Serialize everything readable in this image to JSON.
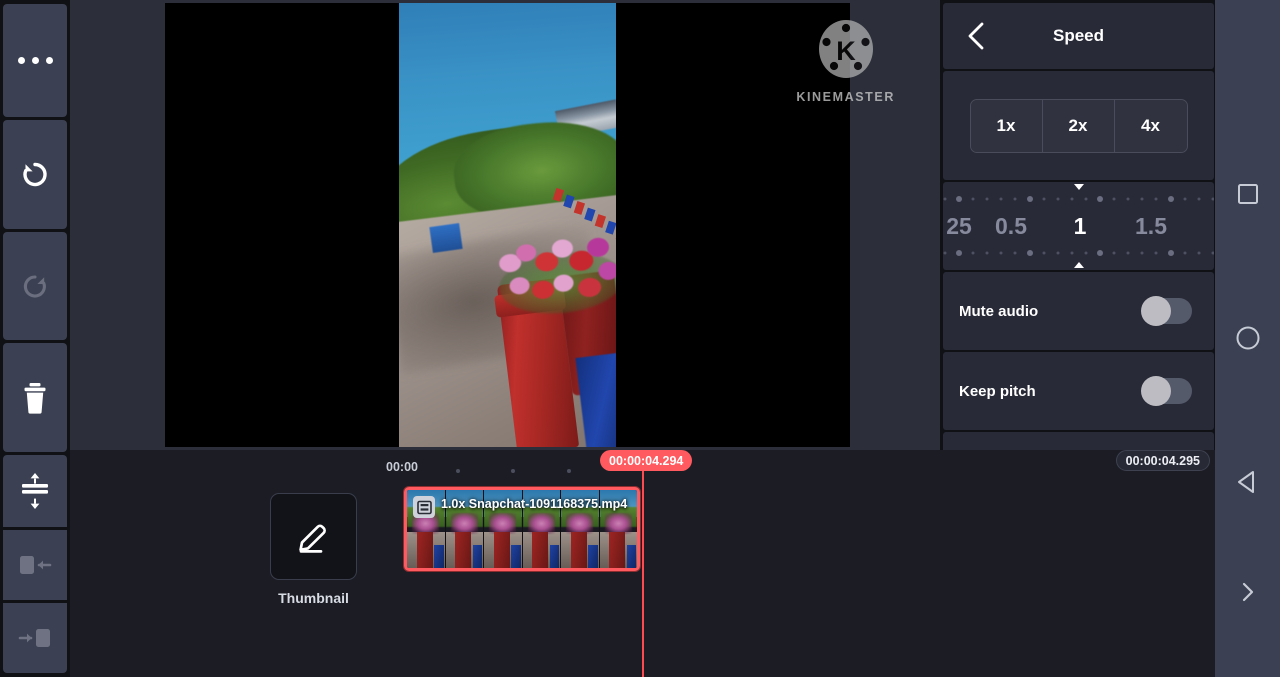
{
  "app": {
    "name": "KineMaster",
    "watermark_text": "KINEMASTER"
  },
  "left_toolbar": {
    "items": [
      {
        "name": "more-options",
        "icon": "ellipsis-icon",
        "enabled": true
      },
      {
        "name": "undo",
        "icon": "undo-icon",
        "enabled": true
      },
      {
        "name": "redo",
        "icon": "redo-icon",
        "enabled": false
      },
      {
        "name": "delete",
        "icon": "trash-icon",
        "enabled": true
      },
      {
        "name": "split",
        "icon": "split-icon",
        "enabled": true
      },
      {
        "name": "trim-left",
        "icon": "trim-left-icon",
        "enabled": false
      },
      {
        "name": "trim-right",
        "icon": "trim-right-icon",
        "enabled": false
      }
    ]
  },
  "panel": {
    "title": "Speed",
    "back_icon": "chevron-left-icon",
    "presets": [
      {
        "label": "1x",
        "value": 1
      },
      {
        "label": "2x",
        "value": 2
      },
      {
        "label": "4x",
        "value": 4
      }
    ],
    "slider": {
      "labels": [
        "25",
        "0.5",
        "1",
        "1.5"
      ],
      "selected_label": "1",
      "selected_value": 1
    },
    "options": [
      {
        "label": "Mute audio",
        "on": false
      },
      {
        "label": "Keep pitch",
        "on": false
      }
    ]
  },
  "timeline": {
    "ruler_start_label": "00:00",
    "playhead_time": "00:00:04.294",
    "total_time": "00:00:04.295",
    "thumbnail": {
      "label": "Thumbnail",
      "icon": "pencil-icon"
    },
    "clip": {
      "speed_label": "1.0x",
      "filename": "Snapchat-1091168375.mp4",
      "title": "1.0x Snapchat-1091168375.mp4",
      "icon": "film-strip-icon",
      "selected": true
    }
  },
  "nav_bar": {
    "items": [
      {
        "name": "recents",
        "icon": "square-icon"
      },
      {
        "name": "home",
        "icon": "circle-icon"
      },
      {
        "name": "back",
        "icon": "triangle-left-icon"
      },
      {
        "name": "expand",
        "icon": "chevron-right-icon"
      }
    ]
  },
  "colors": {
    "accent_red": "#ff5a5f",
    "panel_bg": "#282a37",
    "toolbar_bg": "#3b4152",
    "timeline_bg": "#1b1c24",
    "nav_bg": "#3b4152"
  }
}
